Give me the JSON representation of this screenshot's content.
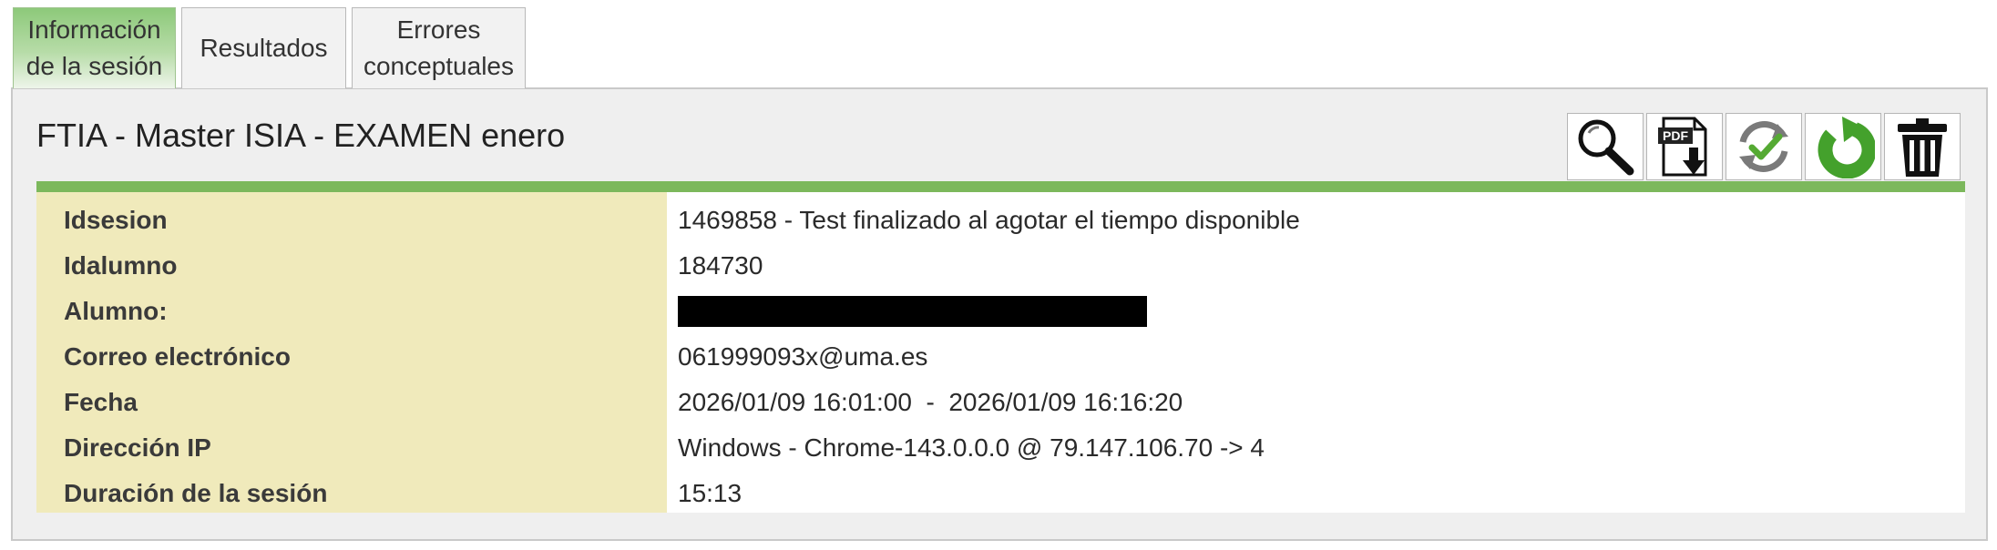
{
  "tabs": [
    {
      "label": "Información\nde la sesión",
      "active": true
    },
    {
      "label": "Resultados",
      "active": false
    },
    {
      "label": "Errores\nconceptuales",
      "active": false
    }
  ],
  "session": {
    "title": "FTIA - Master ISIA - EXAMEN enero"
  },
  "toolbar": {
    "buttons": [
      {
        "icon": "magnifier-icon"
      },
      {
        "icon": "pdf-download-icon",
        "text": "PDF"
      },
      {
        "icon": "refresh-check-icon"
      },
      {
        "icon": "undo-icon"
      },
      {
        "icon": "trash-icon"
      }
    ]
  },
  "info": {
    "rows": [
      {
        "label": "Idsesion",
        "value": "1469858 - Test finalizado al agotar el tiempo disponible"
      },
      {
        "label": "Idalumno",
        "value": "184730"
      },
      {
        "label": "Alumno:",
        "value": "",
        "redacted": true
      },
      {
        "label": "Correo electrónico",
        "value": "061999093x@uma.es"
      },
      {
        "label": "Fecha",
        "value": "2026/01/09 16:01:00  -  2026/01/09 16:16:20"
      },
      {
        "label": "Dirección IP",
        "value": "Windows - Chrome-143.0.0.0 @ 79.147.106.70 -> 4"
      },
      {
        "label": "Duración de la sesión",
        "value": "15:13"
      }
    ]
  },
  "colors": {
    "accent_green": "#7cb85c",
    "label_bg": "#f0eabb",
    "panel_bg": "#efefef"
  }
}
